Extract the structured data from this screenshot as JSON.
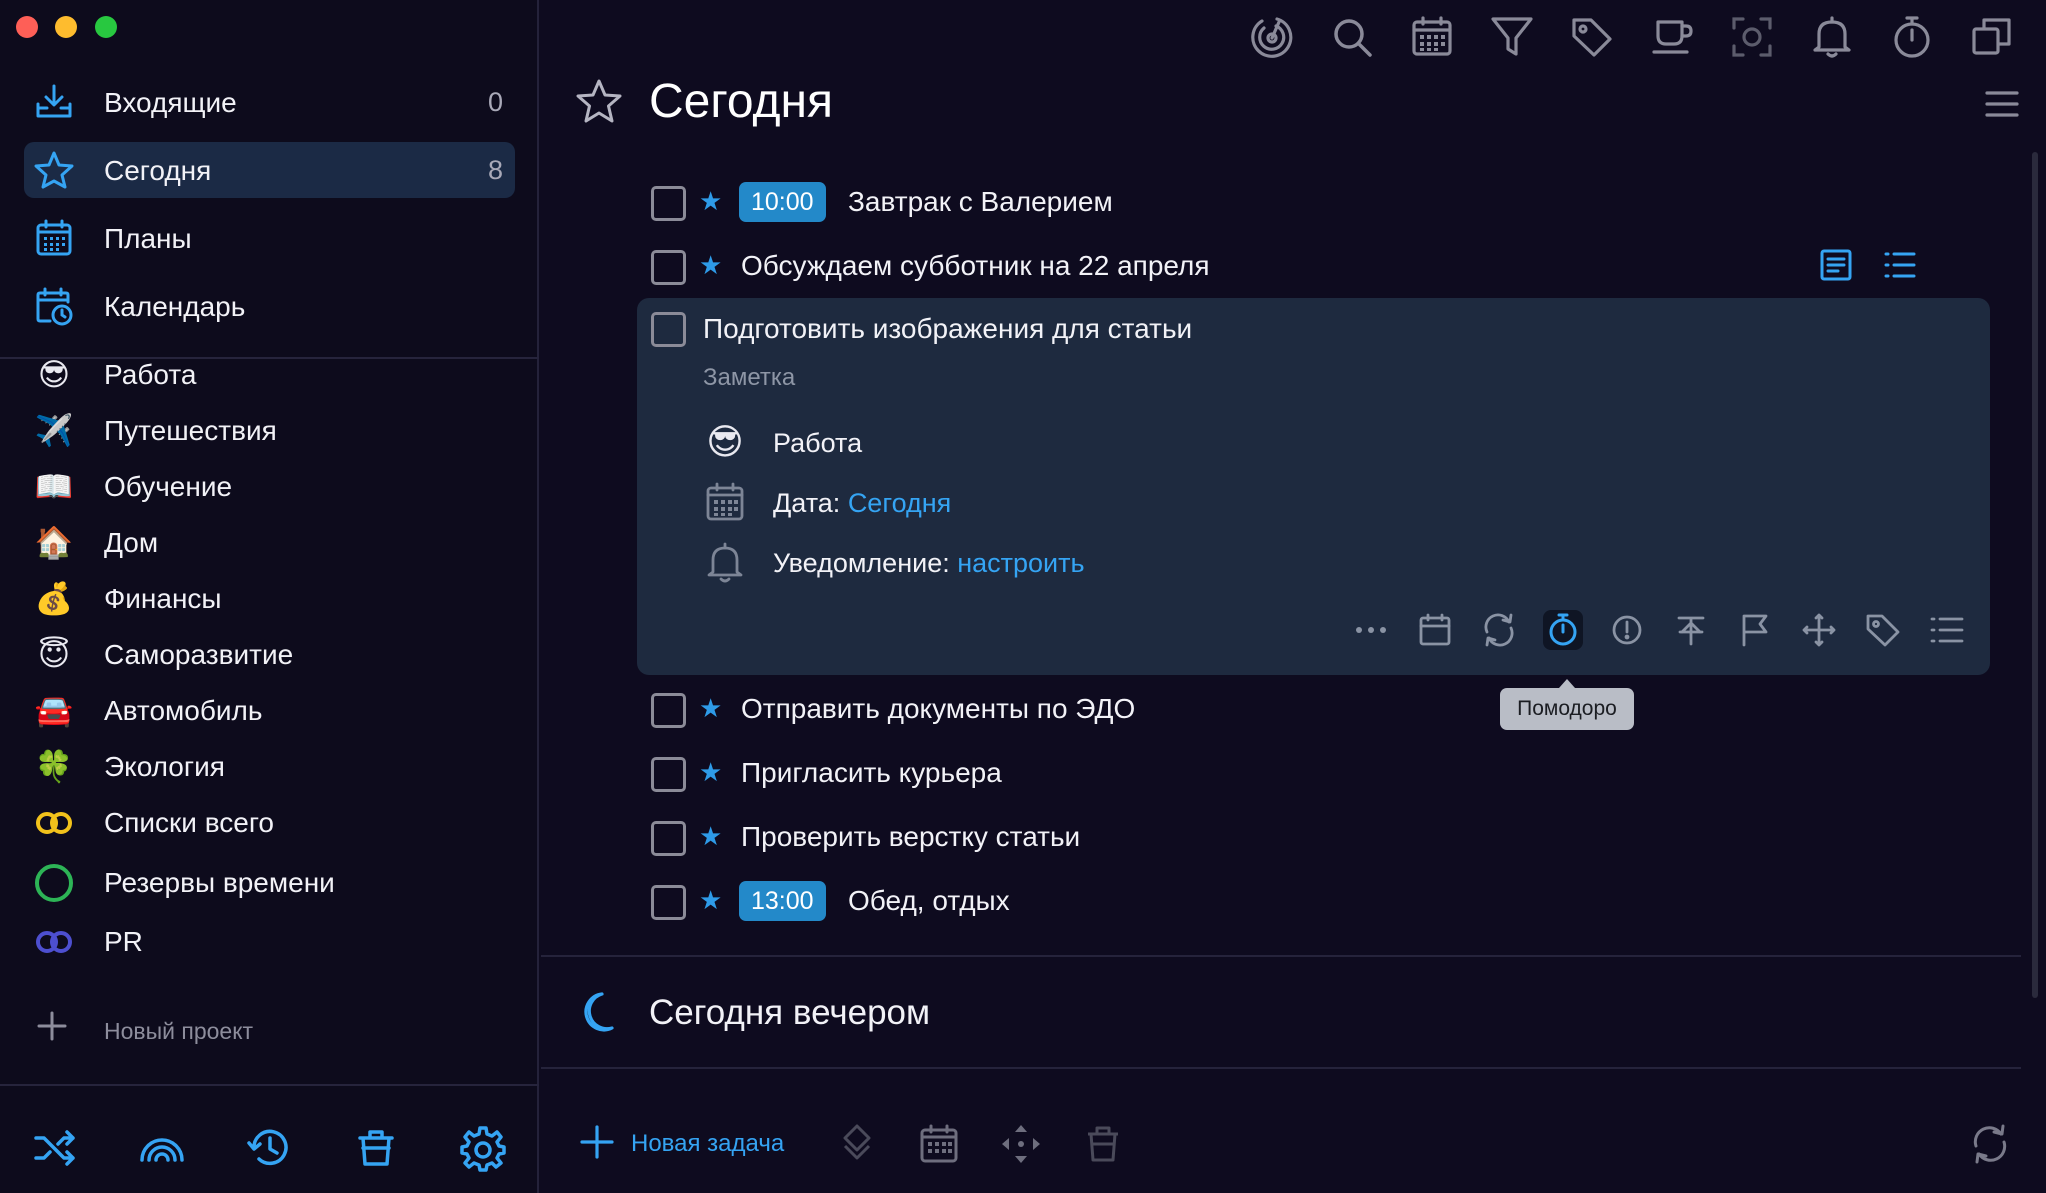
{
  "window": {
    "traffic_lights": [
      "close",
      "minimize",
      "zoom"
    ]
  },
  "sidebar": {
    "nav": [
      {
        "label": "Входящие",
        "count": "0",
        "icon": "inbox-icon"
      },
      {
        "label": "Сегодня",
        "count": "8",
        "icon": "star-icon",
        "active": true
      },
      {
        "label": "Планы",
        "count": "",
        "icon": "calendar-grid-icon"
      },
      {
        "label": "Календарь",
        "count": "",
        "icon": "calendar-clock-icon"
      }
    ],
    "projects": [
      {
        "label": "Работа",
        "icon": "😎"
      },
      {
        "label": "Путешествия",
        "icon": "✈️"
      },
      {
        "label": "Обучение",
        "icon": "📖"
      },
      {
        "label": "Дом",
        "icon": "🏠"
      },
      {
        "label": "Финансы",
        "icon": "💰"
      },
      {
        "label": "Саморазвитие",
        "icon": "😇"
      },
      {
        "label": "Автомобиль",
        "icon": "🚘"
      },
      {
        "label": "Экология",
        "icon": "🍀"
      },
      {
        "label": "Списки всего",
        "icon": "yellow-rings-icon"
      },
      {
        "label": "Резервы времени",
        "icon": "green-circle-icon"
      },
      {
        "label": "PR",
        "icon": "blue-rings-icon"
      }
    ],
    "new_project": "Новый проект",
    "bottom_icons": [
      "shuffle-icon",
      "rainbow-icon",
      "history-icon",
      "trash-icon",
      "settings-icon"
    ]
  },
  "toolbar": {
    "icons": [
      "focus-icon",
      "search-icon",
      "calendar-icon",
      "filter-icon",
      "tag-icon",
      "coffee-icon",
      "screenshot-icon",
      "bell-icon",
      "stopwatch-icon",
      "windows-icon"
    ]
  },
  "page": {
    "title": "Сегодня",
    "evening_title": "Сегодня вечером"
  },
  "tasks": [
    {
      "time": "10:00",
      "title": "Завтрак с Валерием",
      "starred": true
    },
    {
      "time": "",
      "title": "Обсуждаем субботник на 22 апреля",
      "starred": true
    }
  ],
  "expanded_task": {
    "title": "Подготовить изображения для статьи",
    "note_placeholder": "Заметка",
    "project": "Работа",
    "project_icon": "😎",
    "date_label": "Дата:",
    "date_value": "Сегодня",
    "reminder_label": "Уведомление:",
    "reminder_value": "настроить",
    "tools": [
      "more-icon",
      "calendar-icon",
      "repeat-icon",
      "pomodoro-icon",
      "priority-icon",
      "pin-icon",
      "flag-icon",
      "move-icon",
      "tag-icon",
      "checklist-icon"
    ]
  },
  "tooltip": "Помодоро",
  "tasks_after": [
    {
      "time": "",
      "title": "Отправить документы по ЭДО",
      "starred": true
    },
    {
      "time": "",
      "title": "Пригласить курьера",
      "starred": true
    },
    {
      "time": "",
      "title": "Проверить верстку статьи",
      "starred": true
    },
    {
      "time": "13:00",
      "title": "Обед, отдых",
      "starred": true
    }
  ],
  "bottom_bar": {
    "new_task": "Новая задача",
    "icons": [
      "priority-sort-icon",
      "calendar-icon",
      "move-arrows-icon",
      "trash-icon",
      "sync-icon"
    ]
  },
  "colors": {
    "background": "#0e0b1f",
    "accent": "#35a4f3",
    "active_row": "#1b2a45",
    "card": "#1e2a3f",
    "time_badge": "#2389c9"
  }
}
